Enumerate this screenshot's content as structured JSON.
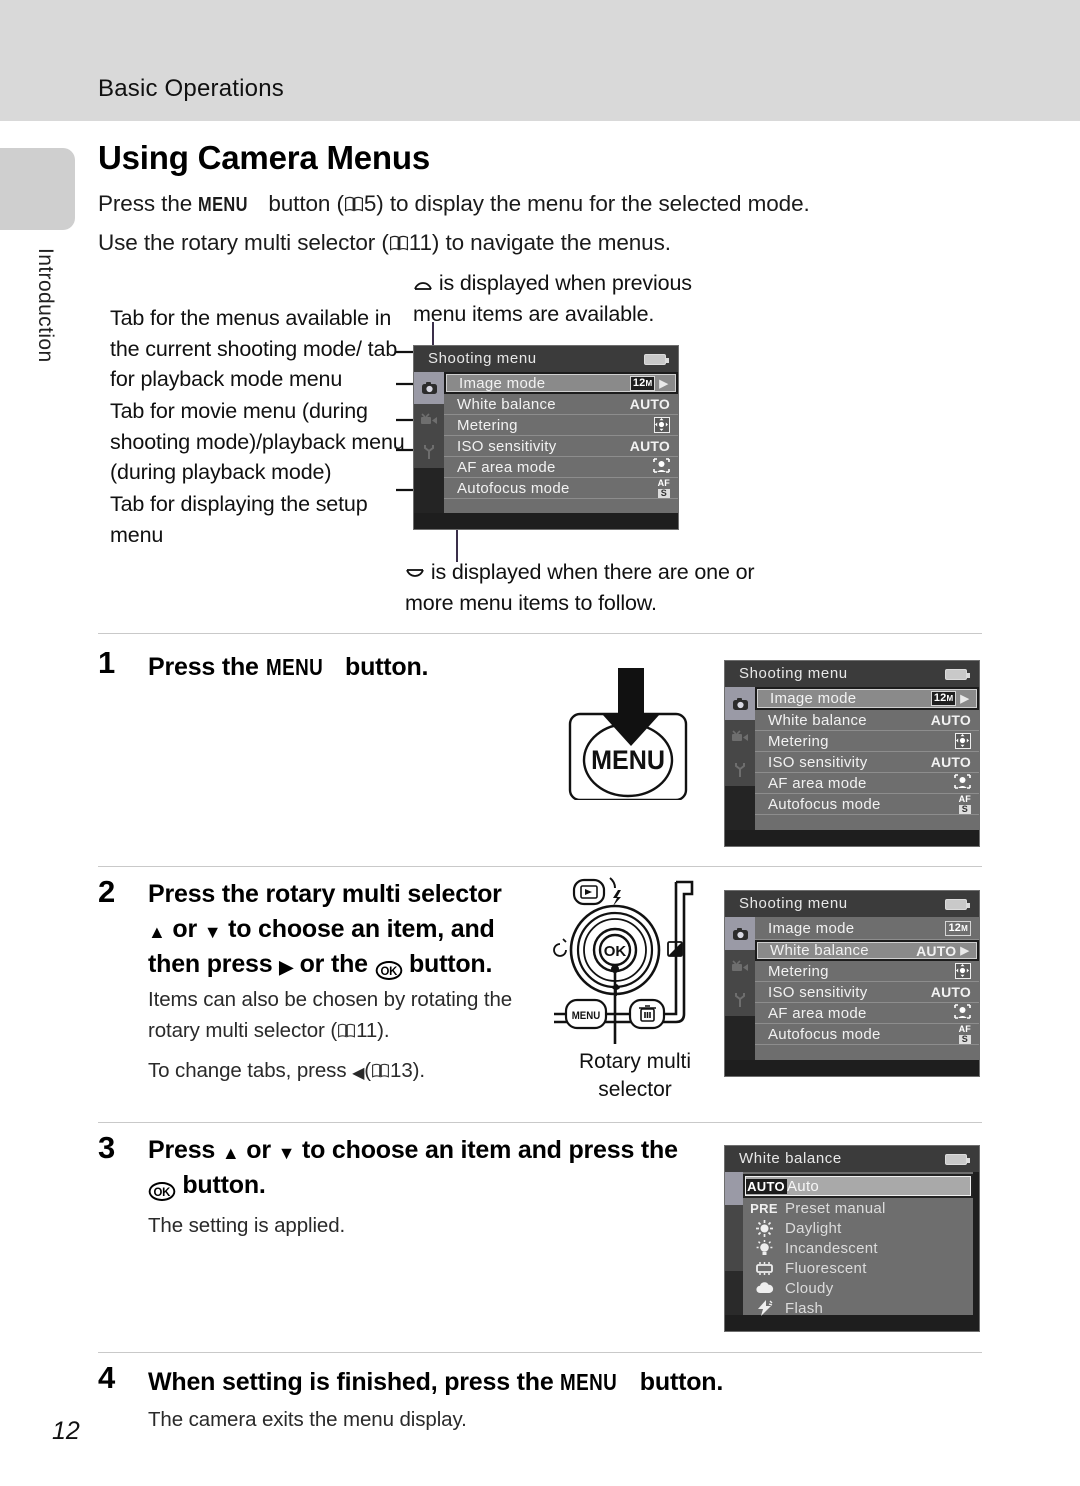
{
  "header": {
    "running_head": "Basic Operations"
  },
  "sidebar": {
    "chapter_label": "Introduction"
  },
  "section": {
    "title": "Using Camera Menus",
    "lead_1_a": "Press the",
    "lead_1_menu": "MENU",
    "lead_1_b": "button (",
    "lead_1_ref": "5) to display the menu for the selected mode.",
    "lead_2_a": "Use the rotary multi selector (",
    "lead_2_ref": "11) to navigate the menus."
  },
  "callouts": {
    "top": "is displayed when previous menu items are available.",
    "left_1": "Tab for the menus available in the current shooting mode/ tab for playback mode menu",
    "left_2": "Tab for movie menu (during shooting mode)/playback menu (during playback mode)",
    "left_3": "Tab for displaying the setup menu",
    "bottom": "is displayed when there are one or more menu items to follow."
  },
  "shooting_menu": {
    "title": "Shooting menu",
    "tabs": [
      "camera-tab",
      "movie-tab",
      "setup-tab"
    ],
    "rows": [
      {
        "label": "Image mode",
        "value": "12",
        "value_sub": "M",
        "value_type": "chip"
      },
      {
        "label": "White balance",
        "value": "AUTO",
        "value_type": "text"
      },
      {
        "label": "Metering",
        "value": "metering-icon",
        "value_type": "icon"
      },
      {
        "label": "ISO sensitivity",
        "value": "AUTO",
        "value_type": "text"
      },
      {
        "label": "AF area mode",
        "value": "af-area-icon",
        "value_type": "icon"
      },
      {
        "label": "Autofocus mode",
        "value": "AF",
        "value_sub": "S",
        "value_type": "af"
      }
    ],
    "highlight_diagram": 0,
    "highlight_step1": 0,
    "highlight_step2": 1
  },
  "white_balance_menu": {
    "title": "White balance",
    "items": [
      {
        "icon": "AUTO",
        "label": "Auto",
        "selected": true
      },
      {
        "icon": "PRE",
        "label": "Preset manual",
        "selected": false
      },
      {
        "icon": "sun-icon",
        "label": "Daylight",
        "selected": false
      },
      {
        "icon": "incandescent-icon",
        "label": "Incandescent",
        "selected": false
      },
      {
        "icon": "fluorescent-icon",
        "label": "Fluorescent",
        "selected": false
      },
      {
        "icon": "cloud-icon",
        "label": "Cloudy",
        "selected": false
      },
      {
        "icon": "flash-icon",
        "label": "Flash",
        "selected": false
      }
    ]
  },
  "steps": [
    {
      "num": "1",
      "head_a": "Press the",
      "head_menu": "MENU",
      "head_b": "button.",
      "body": []
    },
    {
      "num": "2",
      "head_line1": "Press the rotary multi selector",
      "head_line2_a": "or",
      "head_line2_b": "to choose an item, and",
      "head_line3_a": "then press",
      "head_line3_b": "or the",
      "head_line3_c": "button.",
      "body_1": "Items can also be chosen by rotating the rotary multi selector (",
      "body_1_ref": "11).",
      "body_2_a": "To change tabs, press",
      "body_2_ref": "13)."
    },
    {
      "num": "3",
      "head_a": "Press",
      "head_b": "or",
      "head_c": "to choose an item and press the",
      "head_d": "button.",
      "body": "The setting is applied."
    },
    {
      "num": "4",
      "head_a": "When setting is finished, press the",
      "head_menu": "MENU",
      "head_b": "button.",
      "body": "The camera exits the menu display."
    }
  ],
  "illustrations": {
    "menu_button_label": "MENU",
    "rotary_caption": "Rotary multi selector",
    "rotary_buttons": [
      "playback-icon",
      "flash-icon",
      "self-timer-icon",
      "ok-button",
      "exposure-comp-icon",
      "macro-icon",
      "menu-icon",
      "delete-icon"
    ]
  },
  "footer": {
    "page_number": "12"
  },
  "colors": {
    "header_band": "#d9d9d9",
    "lcd_bg": "#1e1e1e",
    "lcd_row": "#6e6e6e",
    "lcd_title": "#3b3b3b",
    "tab_selected": "#9a9aa6"
  }
}
